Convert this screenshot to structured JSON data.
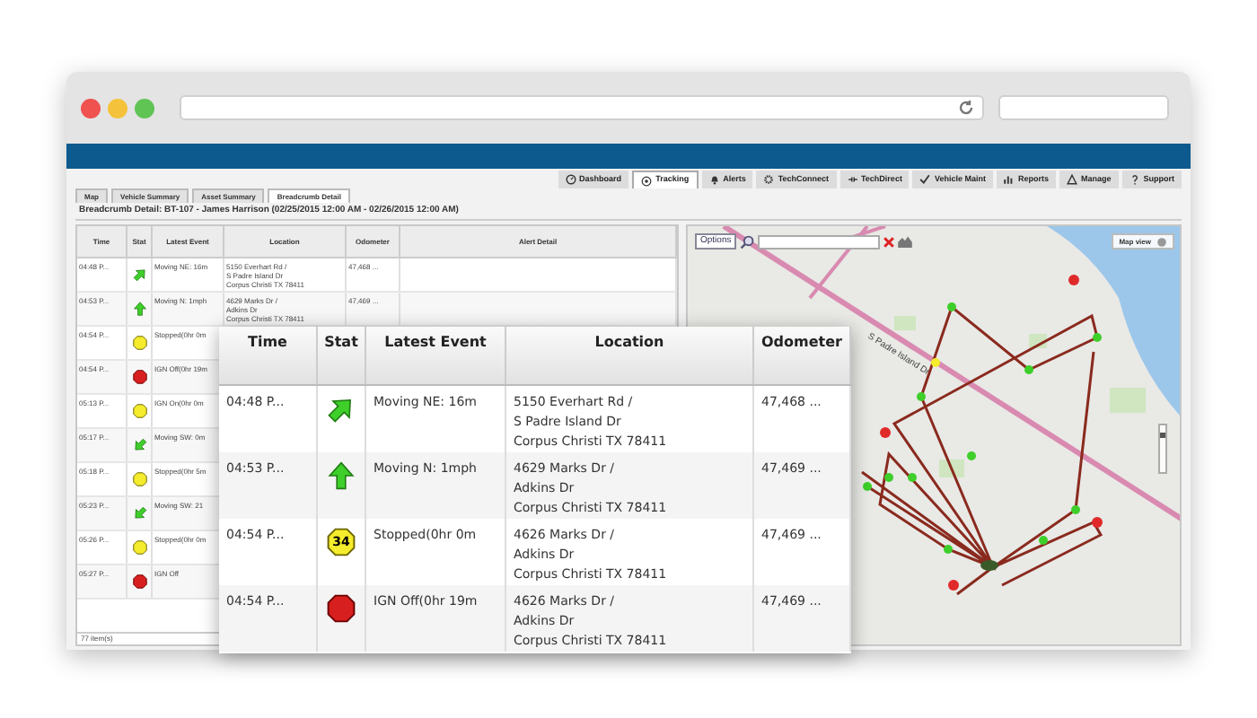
{
  "nav_tabs": [
    {
      "label": "Dashboard",
      "selected": false
    },
    {
      "label": "Tracking",
      "selected": true
    },
    {
      "label": "Alerts",
      "selected": false
    },
    {
      "label": "TechConnect",
      "selected": false
    },
    {
      "label": "TechDirect",
      "selected": false
    },
    {
      "label": "Vehicle Maint",
      "selected": false
    },
    {
      "label": "Reports",
      "selected": false
    },
    {
      "label": "Manage",
      "selected": false
    },
    {
      "label": "Support",
      "selected": false
    }
  ],
  "sub_tabs": [
    {
      "label": "Map",
      "selected": false
    },
    {
      "label": "Vehicle Summary",
      "selected": false
    },
    {
      "label": "Asset Summary",
      "selected": false
    },
    {
      "label": "Breadcrumb Detail",
      "selected": true
    }
  ],
  "title": "Breadcrumb Detail: BT-107 - James Harrison (02/25/2015 12:00 AM - 02/26/2015 12:00 AM)",
  "table": {
    "columns": [
      "Time",
      "Stat",
      "Latest Event",
      "Location",
      "Odometer",
      "Alert Detail"
    ],
    "rows": [
      {
        "time": "04:48 P...",
        "kind": "moving-ne",
        "event": "Moving NE: 16m",
        "location": [
          "5150 Everhart Rd /",
          "S Padre Island Dr",
          "Corpus Christi TX 78411"
        ],
        "odometer": "47,468 ..."
      },
      {
        "time": "04:53 P...",
        "kind": "moving-n",
        "event": "Moving N: 1mph",
        "location": [
          "4629 Marks Dr /",
          "Adkins Dr",
          "Corpus Christi TX 78411"
        ],
        "odometer": "47,469 ..."
      },
      {
        "time": "04:54 P...",
        "kind": "stopped",
        "event": "Stopped(0hr 0m"
      },
      {
        "time": "04:54 P...",
        "kind": "ign-off",
        "event": "IGN Off(0hr 19m"
      },
      {
        "time": "05:13 P...",
        "kind": "stopped",
        "event": "IGN On(0hr 0m"
      },
      {
        "time": "05:17 P...",
        "kind": "moving-sw",
        "event": "Moving SW: 0m"
      },
      {
        "time": "05:18 P...",
        "kind": "stopped",
        "event": "Stopped(0hr 5m"
      },
      {
        "time": "05:23 P...",
        "kind": "moving-sw",
        "event": "Moving SW: 21"
      },
      {
        "time": "05:26 P...",
        "kind": "stopped",
        "event": "Stopped(0hr 0m"
      },
      {
        "time": "05:27 P...",
        "kind": "ign-off",
        "event": "IGN Off"
      }
    ],
    "footer": "77 item(s)"
  },
  "map": {
    "options_button": "Options",
    "map_view_button": "Map view",
    "road_label": "S Padre Island Dr",
    "zoom": {
      "level": 0.85
    }
  },
  "zoomed_table": {
    "columns": [
      "Time",
      "Stat",
      "Latest Event",
      "Location",
      "Odometer"
    ],
    "rows": [
      {
        "time": "04:48 P...",
        "kind": "moving-ne",
        "event": "Moving NE: 16m",
        "location": [
          "5150 Everhart Rd /",
          "S Padre Island Dr",
          "Corpus Christi TX 78411"
        ],
        "odometer": "47,468 ..."
      },
      {
        "time": "04:53 P...",
        "kind": "moving-n",
        "event": "Moving N: 1mph",
        "location": [
          "4629 Marks Dr /",
          "Adkins Dr",
          "Corpus Christi TX 78411"
        ],
        "odometer": "47,469 ..."
      },
      {
        "time": "04:54 P...",
        "kind": "stopped",
        "badge": "34",
        "event": "Stopped(0hr 0m",
        "location": [
          "4626 Marks Dr /",
          "Adkins Dr",
          "Corpus Christi TX 78411"
        ],
        "odometer": "47,469 ..."
      },
      {
        "time": "04:54 P...",
        "kind": "ign-off",
        "event": "IGN Off(0hr 19m",
        "location": [
          "4626 Marks Dr /",
          "Adkins Dr",
          "Corpus Christi TX 78411"
        ],
        "odometer": "47,469 ..."
      }
    ]
  }
}
